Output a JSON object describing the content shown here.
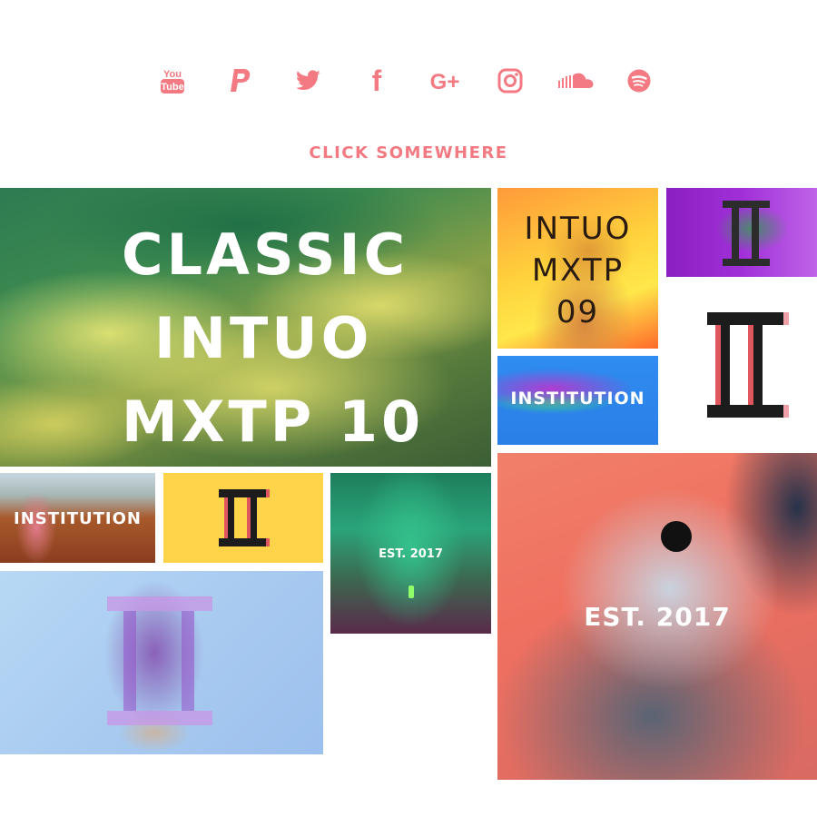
{
  "social": [
    {
      "name": "youtube-icon",
      "label": "You",
      "label2": "Tube"
    },
    {
      "name": "paypal-icon"
    },
    {
      "name": "twitter-icon"
    },
    {
      "name": "facebook-icon",
      "glyph": "f"
    },
    {
      "name": "google-plus-icon",
      "glyph": "G+"
    },
    {
      "name": "instagram-icon"
    },
    {
      "name": "soundcloud-icon"
    },
    {
      "name": "spotify-icon"
    }
  ],
  "cta": "CLICK SOMEWHERE",
  "colors": {
    "accent": "#f37a82"
  },
  "tiles": {
    "classic": {
      "line1": "CLASSIC",
      "line2": "INTUO",
      "line3": "MXTP 10"
    },
    "intuo09": {
      "line1": "INTUO",
      "line2": "MXTP",
      "line3": "09"
    },
    "institution_shark": "INSTITUTION",
    "institution_astronaut": "INSTITUTION",
    "est_waterfall": "EST. 2017",
    "est_falcon": "EST. 2017"
  }
}
